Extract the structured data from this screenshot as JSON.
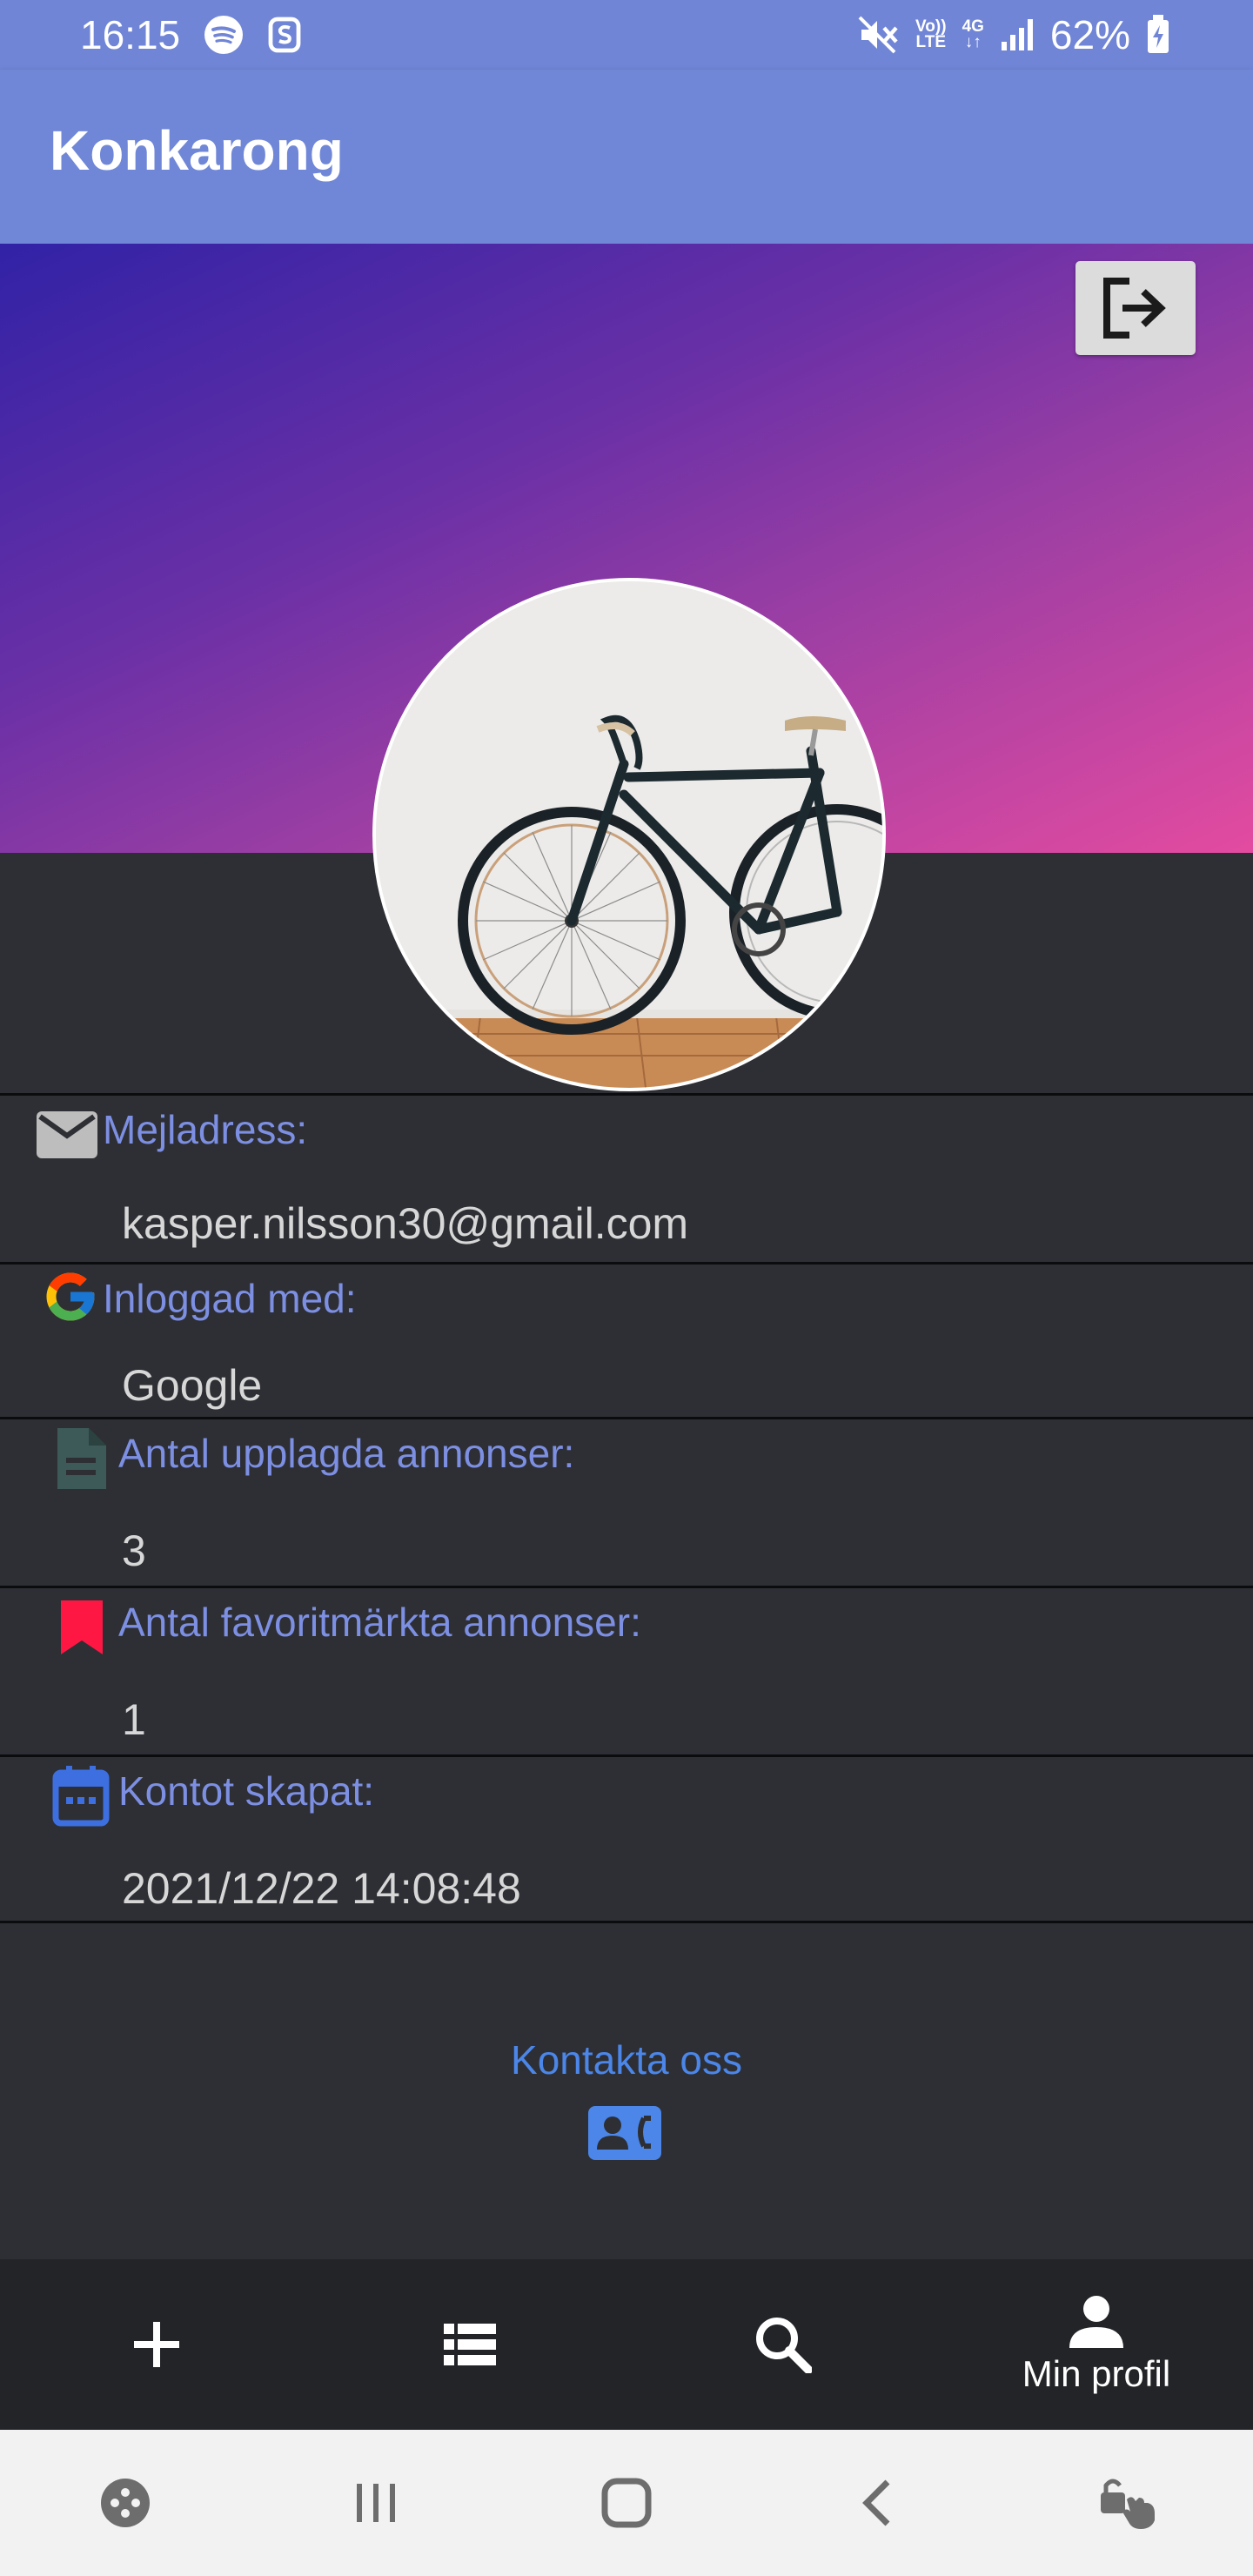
{
  "status_bar": {
    "time": "16:15",
    "left_icons": [
      "spotify-icon",
      "s-app-icon"
    ],
    "volte_top": "Vo))",
    "volte_bottom": "LTE",
    "network": "4G",
    "battery_percent": "62%",
    "right_icons": [
      "mute-icon",
      "volte-icon",
      "network-4g-icon",
      "signal-icon",
      "battery-charging-icon"
    ]
  },
  "app_bar": {
    "title": "Konkarong"
  },
  "header": {
    "banner_gradient": [
      "#3122a6",
      "#6a30a6",
      "#9a3ea4",
      "#e34ba0"
    ],
    "logout_icon": "logout-icon",
    "avatar_image": "bicycle-photo"
  },
  "profile": {
    "rows": [
      {
        "icon": "email-icon",
        "label": "Mejladress:",
        "value": "kasper.nilsson30@gmail.com"
      },
      {
        "icon": "google-icon",
        "label": "Inloggad med:",
        "value": "Google"
      },
      {
        "icon": "document-icon",
        "label": "Antal upplagda annonser:",
        "value": "3"
      },
      {
        "icon": "bookmark-icon",
        "label": "Antal favoritmärkta annonser:",
        "value": "1"
      },
      {
        "icon": "calendar-icon",
        "label": "Kontot skapat:",
        "value": "2021/12/22 14:08:48"
      }
    ]
  },
  "contact": {
    "label": "Kontakta oss",
    "icon": "contact-card-icon"
  },
  "bottom_nav": {
    "items": [
      {
        "icon": "add-icon",
        "label": ""
      },
      {
        "icon": "list-icon",
        "label": ""
      },
      {
        "icon": "search-icon",
        "label": ""
      },
      {
        "icon": "person-icon",
        "label": "Min profil"
      }
    ]
  },
  "system_nav": {
    "items": [
      "game-launcher-icon",
      "recent-apps-icon",
      "home-icon",
      "back-icon",
      "accessibility-icon"
    ]
  },
  "colors": {
    "app_bar": "#7087d8",
    "background": "#2d2f34",
    "label": "#7d8fe2",
    "value": "#d7d7d7",
    "link": "#4b86e8",
    "bookmark": "#ff1744",
    "document": "#3d5a58",
    "calendar": "#3d6fe0"
  }
}
